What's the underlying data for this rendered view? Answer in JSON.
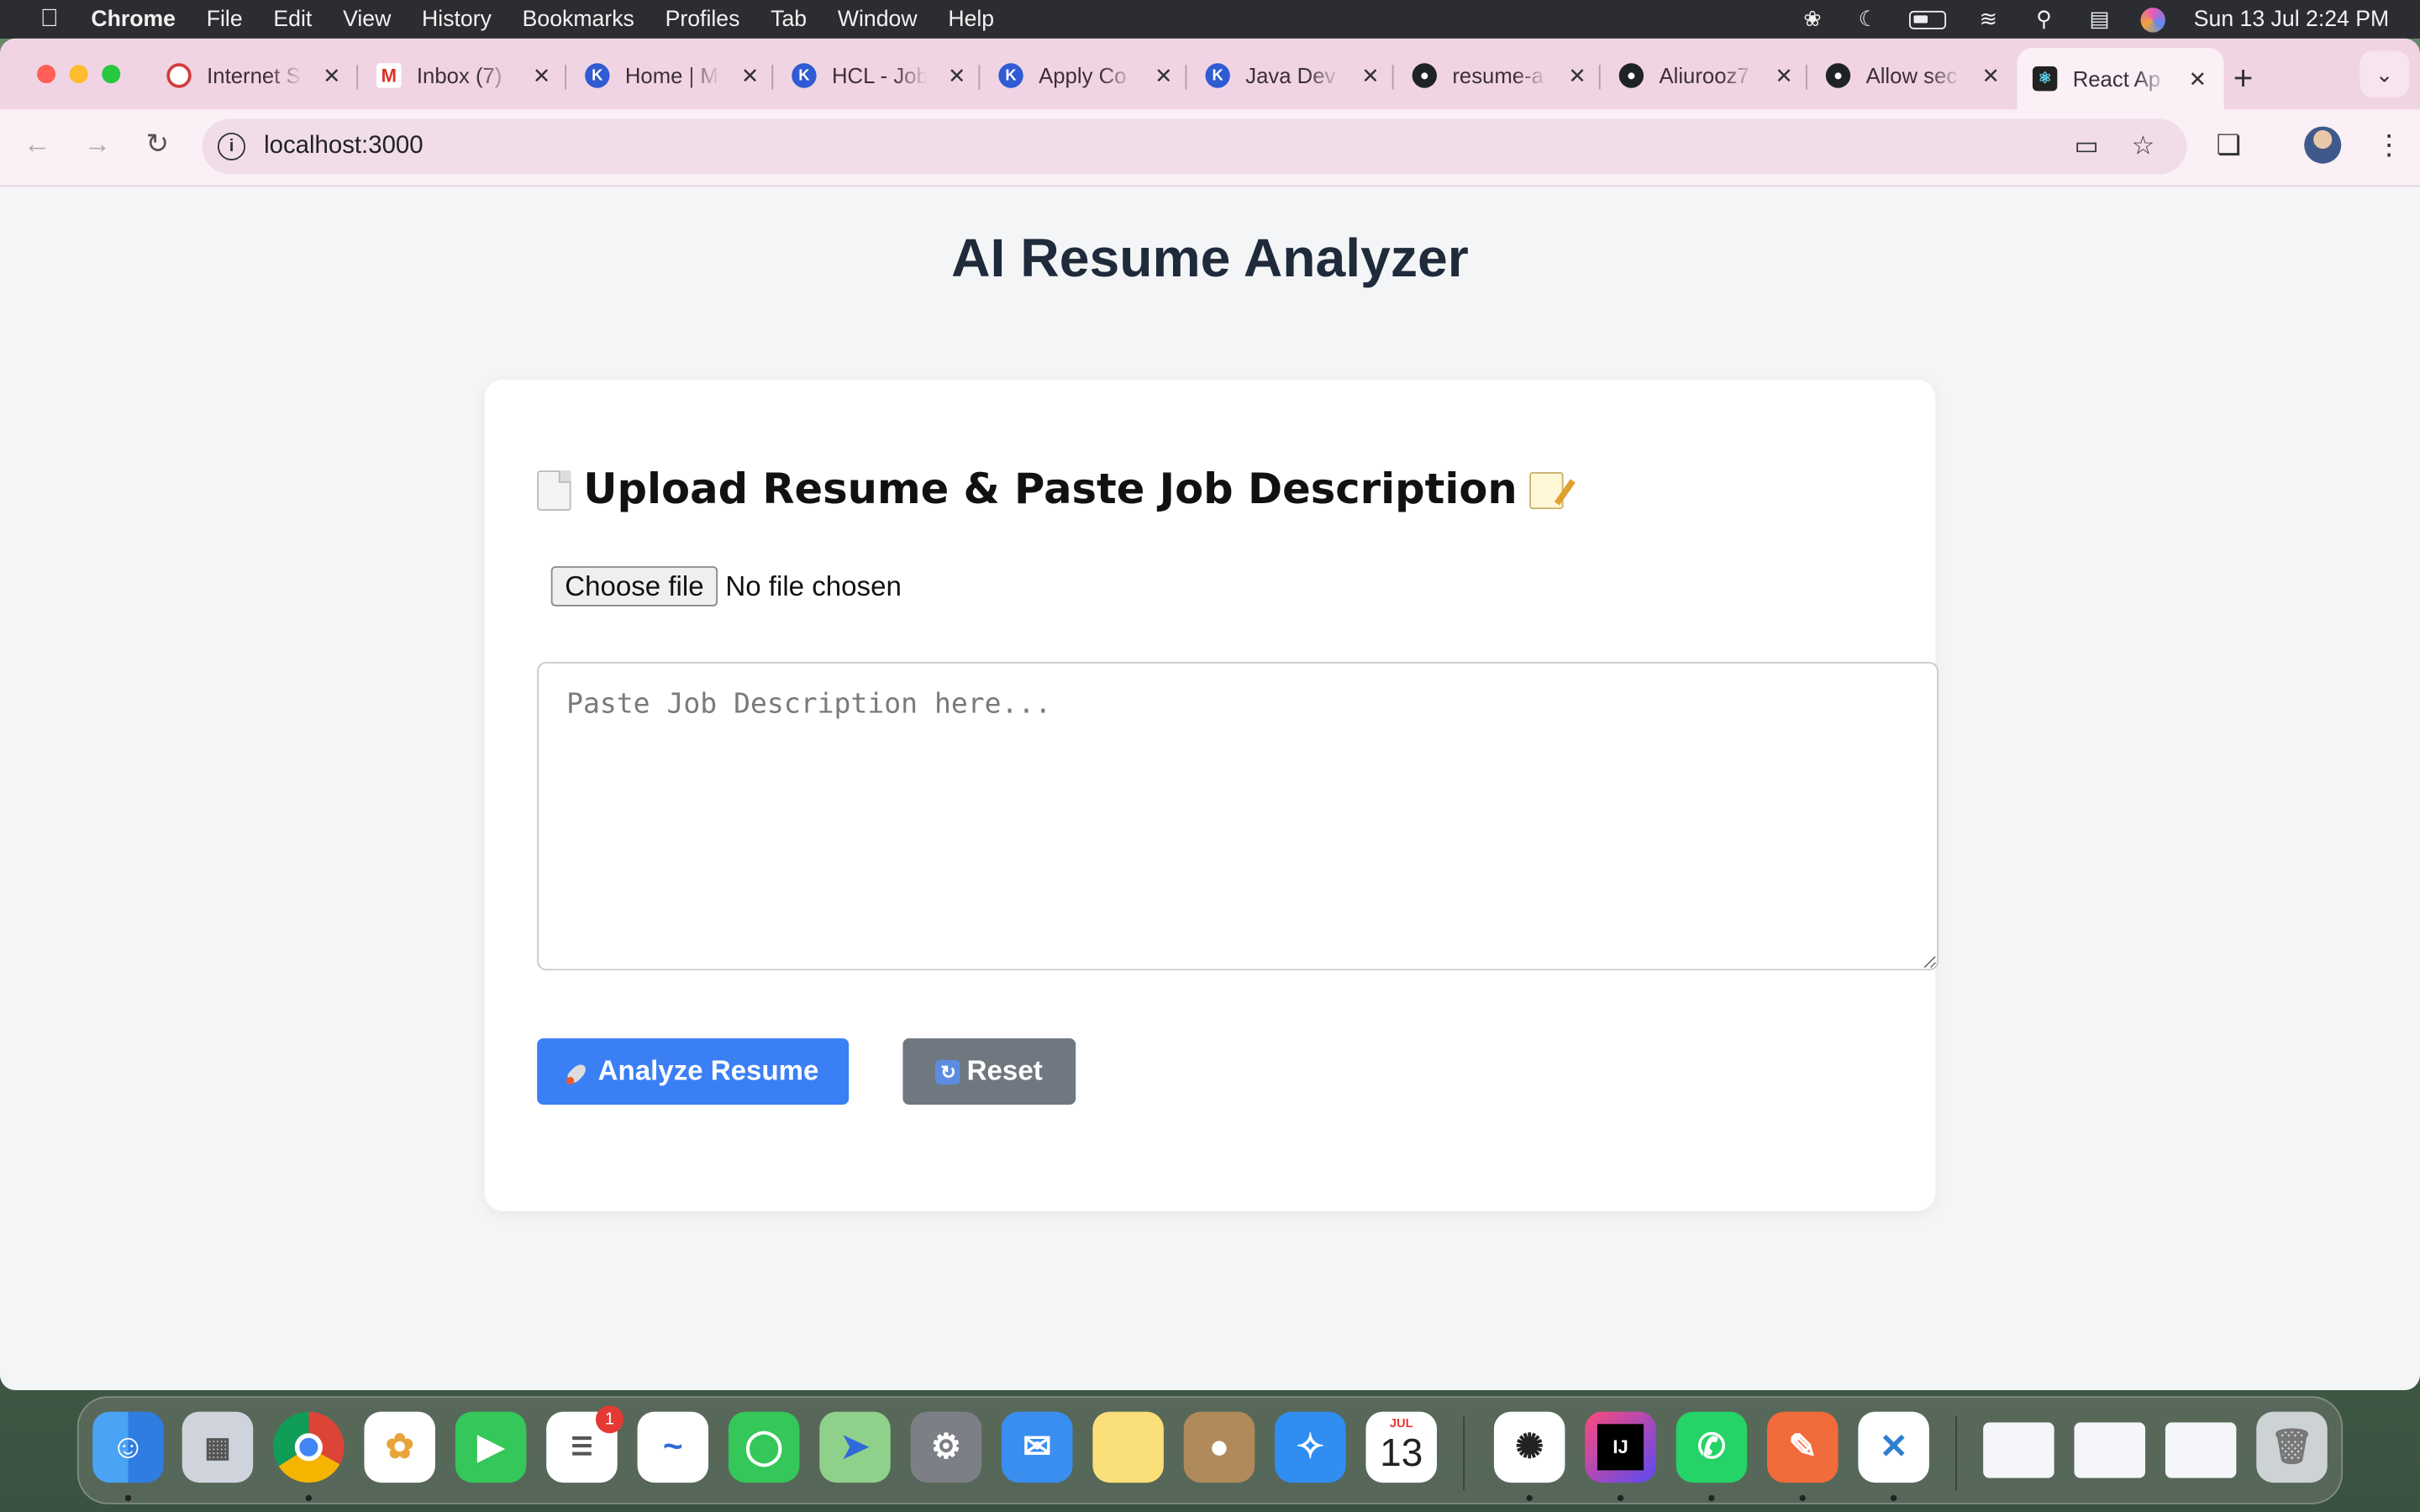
{
  "menubar": {
    "app": "Chrome",
    "menus": [
      "File",
      "Edit",
      "View",
      "History",
      "Bookmarks",
      "Profiles",
      "Tab",
      "Window",
      "Help"
    ],
    "clock": "Sun 13 Jul  2:24 PM"
  },
  "tabs": [
    {
      "title": "Internet Speed",
      "favicon": "speedtest-icon"
    },
    {
      "title": "Inbox (7)",
      "favicon": "gmail-icon"
    },
    {
      "title": "Home | My",
      "favicon": "k-icon"
    },
    {
      "title": "HCL - Jobs",
      "favicon": "k-icon"
    },
    {
      "title": "Apply Co",
      "favicon": "k-icon"
    },
    {
      "title": "Java Dev",
      "favicon": "k-icon"
    },
    {
      "title": "resume-a",
      "favicon": "github-icon"
    },
    {
      "title": "Aliurooz7",
      "favicon": "github-icon"
    },
    {
      "title": "Allow sec",
      "favicon": "github-icon"
    },
    {
      "title": "React Ap",
      "favicon": "react-icon",
      "active": true
    }
  ],
  "toolbar": {
    "url": "localhost:3000"
  },
  "page": {
    "title": "AI Resume Analyzer",
    "heading": "Upload Resume & Paste Job Description",
    "file_button": "Choose file",
    "file_status": "No file chosen",
    "jd_placeholder": "Paste Job Description here...",
    "jd_value": "",
    "analyze_label": "Analyze Resume",
    "reset_label": "Reset"
  },
  "dock": {
    "reminders_badge": "1",
    "calendar_month": "JUL",
    "calendar_day": "13"
  },
  "colors": {
    "primary_button": "#3b7ff5",
    "secondary_button": "#6f7780",
    "tabstrip": "#f1d4e4"
  }
}
